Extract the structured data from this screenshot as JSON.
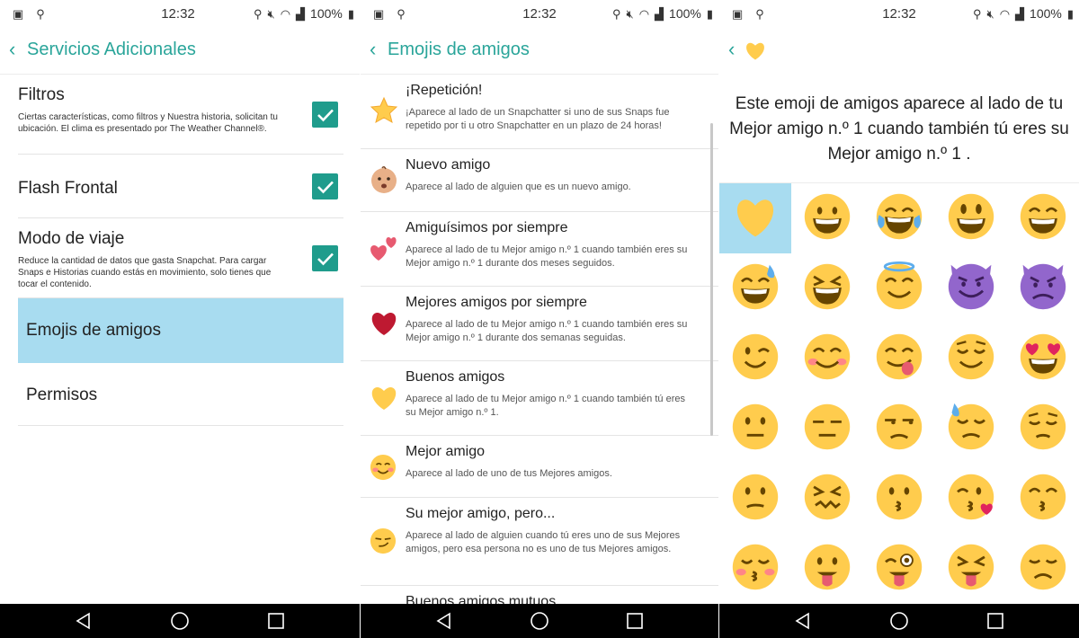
{
  "statusbar": {
    "time": "12:32",
    "battery": "100%"
  },
  "panel1": {
    "title": "Servicios Adicionales",
    "items": [
      {
        "title": "Filtros",
        "desc": "Ciertas características, como filtros y Nuestra historia, solicitan tu ubicación. El clima es presentado por The Weather Channel®.",
        "checked": true
      },
      {
        "title": "Flash Frontal",
        "desc": "",
        "checked": true
      },
      {
        "title": "Modo de viaje",
        "desc": "Reduce la cantidad de datos que gasta Snapchat. Para cargar Snaps e Historias cuando estás en movimiento, solo tienes que tocar el contenido.",
        "checked": true
      },
      {
        "title": "Emojis de amigos",
        "desc": "",
        "selected": true
      },
      {
        "title": "Permisos",
        "desc": ""
      }
    ]
  },
  "panel2": {
    "title": "Emojis de amigos",
    "items": [
      {
        "icon": "star-icon",
        "title": "¡Repetición!",
        "desc": "¡Aparece al lado de un Snapchatter si uno de sus Snaps fue repetido por ti u otro Snapchatter en un plazo de 24 horas!"
      },
      {
        "icon": "baby-icon",
        "title": "Nuevo amigo",
        "desc": "Aparece al lado de alguien que es un nuevo amigo."
      },
      {
        "icon": "two-hearts-icon",
        "title": "Amiguísimos por siempre",
        "desc": "Aparece al lado de tu Mejor amigo n.º 1 cuando también eres su Mejor amigo n.º 1 durante dos meses seguidos."
      },
      {
        "icon": "red-heart-icon",
        "title": "Mejores amigos por siempre",
        "desc": "Aparece al lado de tu Mejor amigo n.º 1 cuando también eres su Mejor amigo n.º 1 durante dos semanas seguidas."
      },
      {
        "icon": "yellow-heart-icon",
        "title": "Buenos amigos",
        "desc": "Aparece al lado de tu Mejor amigo n.º 1 cuando también tú eres su Mejor amigo n.º 1."
      },
      {
        "icon": "blush-smile-icon",
        "title": "Mejor amigo",
        "desc": "Aparece al lado de uno de tus Mejores amigos."
      },
      {
        "icon": "smirk-icon",
        "title": "Su mejor amigo, pero...",
        "desc": "Aparece al lado de alguien cuando tú eres uno de sus Mejores amigos, pero esa persona no es uno de tus Mejores amigos."
      },
      {
        "icon": "",
        "title": "Buenos amigos mutuos",
        "desc": ""
      }
    ]
  },
  "panel3": {
    "header_icon": "yellow-heart-icon",
    "desc": "Este emoji de amigos aparece al lado de tu Mejor amigo n.º 1 cuando también tú eres su Mejor amigo n.º 1 .",
    "emojis": [
      "yellow-heart",
      "grinning",
      "joy",
      "smiley",
      "smile",
      "sweat-smile",
      "laughing",
      "innocent",
      "smiling-imp",
      "imp",
      "wink",
      "blush",
      "yum",
      "relieved",
      "heart-eyes",
      "neutral",
      "expressionless",
      "unamused",
      "sweat",
      "pensive",
      "confused",
      "confounded",
      "kissing",
      "kissing-heart",
      "kissing-smiling-eyes",
      "kissing-closed-eyes",
      "tongue",
      "tongue-wink",
      "tongue-squint",
      "disappointed"
    ],
    "selected_index": 0
  },
  "colors": {
    "accent": "#2aa59a",
    "checkbox": "#1f9c8c",
    "highlight": "#a8dcf0",
    "emoji_yellow": "#ffcc4d"
  }
}
